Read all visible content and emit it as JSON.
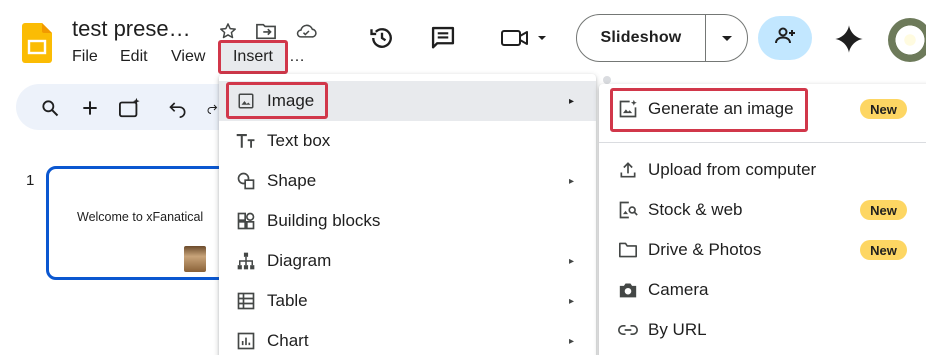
{
  "app": {
    "title": "test prese…",
    "logo_icon": "google-slides-logo",
    "accent_color": "#fbbc04"
  },
  "menubar": {
    "file": "File",
    "edit": "Edit",
    "view": "View",
    "insert": "Insert",
    "more": "…"
  },
  "header": {
    "slideshow_label": "Slideshow",
    "icons": [
      "star-icon",
      "move-to-folder-icon",
      "cloud-saved-icon",
      "version-history-icon",
      "comments-icon",
      "meet-icon",
      "share-icon",
      "gemini-icon",
      "avatar"
    ]
  },
  "toolbar": {
    "icons": [
      "search-icon",
      "new-slide-icon",
      "magic-icon",
      "undo-icon"
    ]
  },
  "slides": [
    {
      "number": "1",
      "text": "Welcome to xFanatical"
    }
  ],
  "insert_menu": {
    "items": [
      {
        "label": "Image",
        "icon": "image-icon",
        "has_submenu": true
      },
      {
        "label": "Text box",
        "icon": "text-box-icon",
        "has_submenu": false
      },
      {
        "label": "Shape",
        "icon": "shape-icon",
        "has_submenu": true
      },
      {
        "label": "Building blocks",
        "icon": "building-blocks-icon",
        "has_submenu": false
      },
      {
        "label": "Diagram",
        "icon": "diagram-icon",
        "has_submenu": true
      },
      {
        "label": "Table",
        "icon": "table-icon",
        "has_submenu": true
      },
      {
        "label": "Chart",
        "icon": "chart-icon",
        "has_submenu": true
      }
    ],
    "arrow": "▸"
  },
  "image_submenu": {
    "items": [
      {
        "label": "Generate an image",
        "icon": "generate-image-icon",
        "badge": "New"
      },
      {
        "label": "Upload from computer",
        "icon": "upload-icon",
        "badge": ""
      },
      {
        "label": "Stock & web",
        "icon": "stock-image-icon",
        "badge": "New"
      },
      {
        "label": "Drive & Photos",
        "icon": "folder-icon",
        "badge": "New"
      },
      {
        "label": "Camera",
        "icon": "camera-icon",
        "badge": ""
      },
      {
        "label": "By URL",
        "icon": "link-icon",
        "badge": ""
      }
    ]
  },
  "colors": {
    "highlight_border": "#d1374a",
    "badge_bg": "#fdd663",
    "selection_blue": "#0b57d0",
    "share_bg": "#c2e7ff"
  }
}
